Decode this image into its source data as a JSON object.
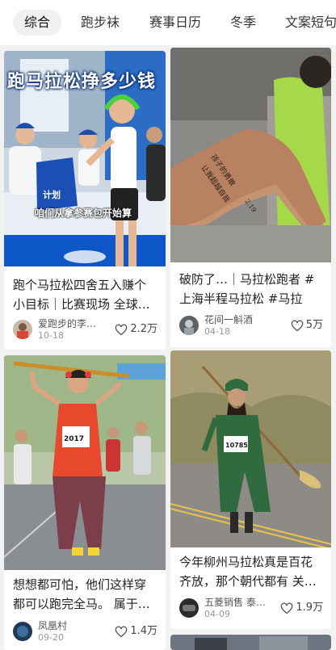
{
  "tabs": [
    {
      "label": "综合",
      "active": true
    },
    {
      "label": "跑步袜",
      "active": false
    },
    {
      "label": "赛事日历",
      "active": false
    },
    {
      "label": "冬季",
      "active": false
    },
    {
      "label": "文案短句",
      "active": false
    }
  ],
  "cards": [
    {
      "title": "跑个马拉松四舍五入赚个小目标｜比赛现场 全球…",
      "image_overlay_title": "跑马拉松挣多少钱",
      "image_overlay_subtitle": "咱们从拿参赛包开始算",
      "author": "爱跑步的李…",
      "date": "10-18",
      "likes": "2.2万",
      "icon": "heart-icon"
    },
    {
      "title": "破防了…｜马拉松跑者 #上海半程马拉松 #马拉松…",
      "tattoo_text": "孩子的勇敢 让我超越自我 2.19",
      "author": "花间一斛酒",
      "date": "04-18",
      "likes": "5万",
      "icon": "heart-icon"
    },
    {
      "title": "想想都可怕，他们这样穿都可以跑完全马。 属于…",
      "bib": "2017",
      "author": "凤凰村",
      "date": "09-20",
      "likes": "1.4万",
      "icon": "heart-icon"
    },
    {
      "title": "今年柳州马拉松真是百花齐放，那个朝代都有 关…",
      "bib": "10785",
      "author": "五菱销售 泰…",
      "date": "04-09",
      "likes": "1.9万",
      "icon": "heart-icon"
    }
  ]
}
